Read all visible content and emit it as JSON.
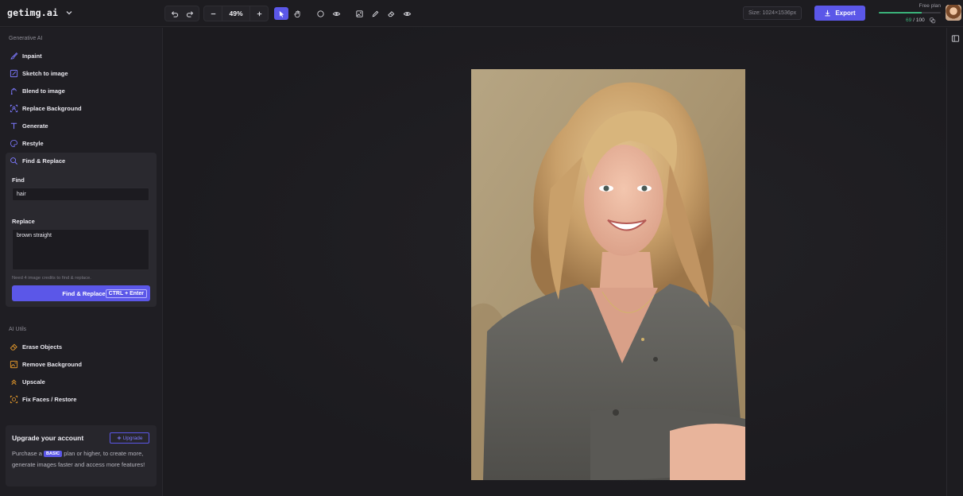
{
  "app": {
    "logo": "getimg.ai"
  },
  "toolbar": {
    "zoom": "49%",
    "size_label": "Size: 1024×1536px",
    "export_label": "Export"
  },
  "plan": {
    "name": "Free plan",
    "credits_used": "69",
    "credits_total": "/ 100",
    "usage_fraction": 0.69,
    "accent": "#3bb37a"
  },
  "sidebar": {
    "generative_title": "Generative AI",
    "generative_items": [
      {
        "label": "Inpaint",
        "icon": "brush-icon"
      },
      {
        "label": "Sketch to image",
        "icon": "sketch-icon"
      },
      {
        "label": "Blend to image",
        "icon": "blend-icon"
      },
      {
        "label": "Replace Background",
        "icon": "background-icon"
      },
      {
        "label": "Generate",
        "icon": "text-icon"
      },
      {
        "label": "Restyle",
        "icon": "palette-icon"
      },
      {
        "label": "Find & Replace",
        "icon": "search-replace-icon"
      }
    ],
    "find_replace": {
      "find_label": "Find",
      "find_value": "hair",
      "replace_label": "Replace",
      "replace_value": "brown straight",
      "hint": "Need 4 image credits to find & replace.",
      "button_label": "Find & Replace",
      "shortcut": "CTRL + Enter"
    },
    "utils_title": "AI Utils",
    "utils_items": [
      {
        "label": "Erase Objects",
        "icon": "eraser-icon"
      },
      {
        "label": "Remove Background",
        "icon": "remove-bg-icon"
      },
      {
        "label": "Upscale",
        "icon": "upscale-icon"
      },
      {
        "label": "Fix Faces / Restore",
        "icon": "face-restore-icon"
      }
    ],
    "upgrade": {
      "title": "Upgrade your account",
      "button_label": "Upgrade",
      "text_before": "Purchase a",
      "badge": "BASIC",
      "text_after": "plan or higher, to create more, generate images faster and access more features!"
    }
  },
  "colors": {
    "accent": "#5b57e8",
    "util_icon": "#e0962b"
  }
}
